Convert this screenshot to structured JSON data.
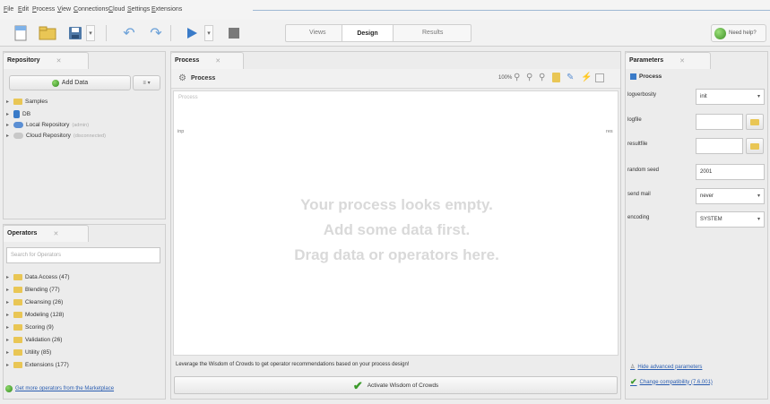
{
  "menu": [
    "File",
    "Edit",
    "Process",
    "View",
    "Connections",
    "Cloud",
    "Settings",
    "Extensions"
  ],
  "views": {
    "left": "Views",
    "active": "Design",
    "right": "Results"
  },
  "help_label": "Need help?",
  "repository": {
    "title": "Repository",
    "add_data": "Add Data",
    "items": [
      {
        "label": "Samples",
        "sub": ""
      },
      {
        "label": "DB",
        "sub": ""
      },
      {
        "label": "Local Repository",
        "sub": "(admin)"
      },
      {
        "label": "Cloud Repository",
        "sub": "(disconnected)"
      }
    ]
  },
  "operators": {
    "title": "Operators",
    "search_placeholder": "Search for Operators",
    "items": [
      "Data Access (47)",
      "Blending (77)",
      "Cleansing (26)",
      "Modeling (128)",
      "Scoring (9)",
      "Validation (26)",
      "Utility (85)",
      "Extensions (177)"
    ],
    "marketplace_link": "Get more operators from the Marketplace"
  },
  "process": {
    "title": "Process",
    "breadcrumb": "Process",
    "zoom": "100%",
    "canvas_label": "Process",
    "inp": "inp",
    "res": "res",
    "empty_lines": [
      "Your process looks empty.",
      "Add some data first.",
      "Drag data or operators here."
    ],
    "wisdom_text": "Leverage the Wisdom of Crowds to get operator recommendations based on your process design!",
    "activate_label": "Activate Wisdom of Crowds"
  },
  "parameters": {
    "title": "Parameters",
    "process_label": "Process",
    "rows": [
      {
        "label": "logverbosity",
        "value": "init",
        "kind": "select"
      },
      {
        "label": "logfile",
        "value": "",
        "kind": "file"
      },
      {
        "label": "resultfile",
        "value": "",
        "kind": "file"
      },
      {
        "label": "random seed",
        "value": "2001",
        "kind": "text"
      },
      {
        "label": "send mail",
        "value": "never",
        "kind": "select"
      },
      {
        "label": "encoding",
        "value": "SYSTEM",
        "kind": "select"
      }
    ],
    "hide_advanced": "Hide advanced parameters",
    "change_compat": "Change compatibility (7.6.001)"
  },
  "colors": {
    "accent_blue": "#3a7bc8",
    "green": "#3c9a2b",
    "folder": "#e9c655"
  }
}
